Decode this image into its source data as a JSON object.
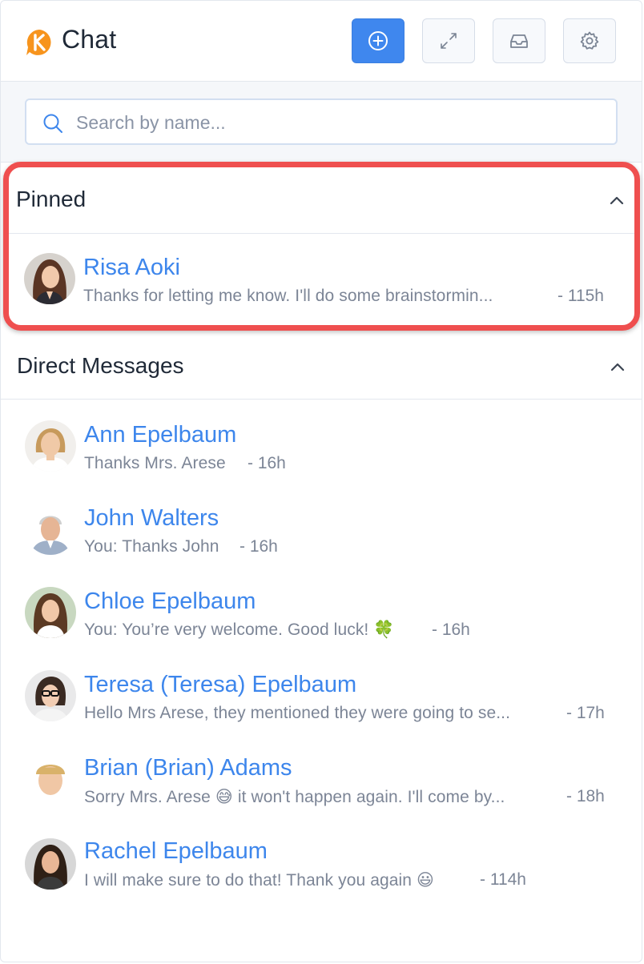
{
  "app": {
    "title": "Chat"
  },
  "header": {
    "buttons": [
      {
        "icon": "plus-circle-icon"
      },
      {
        "icon": "expand-icon"
      },
      {
        "icon": "inbox-icon"
      },
      {
        "icon": "gear-icon"
      }
    ]
  },
  "search": {
    "placeholder": "Search by name...",
    "value": ""
  },
  "pinned": {
    "title": "Pinned",
    "items": [
      {
        "name": "Risa Aoki",
        "preview": "Thanks for letting me know. I'll do some brainstormin...",
        "time": "- 115h"
      }
    ]
  },
  "direct": {
    "title": "Direct Messages",
    "items": [
      {
        "name": "Ann Epelbaum",
        "preview": "Thanks Mrs. Arese",
        "time": "- 16h"
      },
      {
        "name": "John Walters",
        "preview": "You: Thanks John",
        "time": "- 16h"
      },
      {
        "name": "Chloe Epelbaum",
        "preview": "You: You’re very welcome. Good luck! 🍀",
        "time": "- 16h"
      },
      {
        "name": "Teresa (Teresa) Epelbaum",
        "preview": "Hello Mrs Arese, they mentioned they were going to se...",
        "time": "- 17h"
      },
      {
        "name": "Brian (Brian) Adams",
        "preview": "Sorry Mrs. Arese 😅 it won't happen again. I'll come by...",
        "time": "- 18h"
      },
      {
        "name": "Rachel Epelbaum",
        "preview": "I will make sure to do that! Thank you again 😃",
        "time": "- 114h"
      }
    ]
  },
  "colors": {
    "accent": "#3f87ee",
    "highlight": "#ef4f4f",
    "name": "#3d86ec",
    "muted": "#7c8596"
  }
}
